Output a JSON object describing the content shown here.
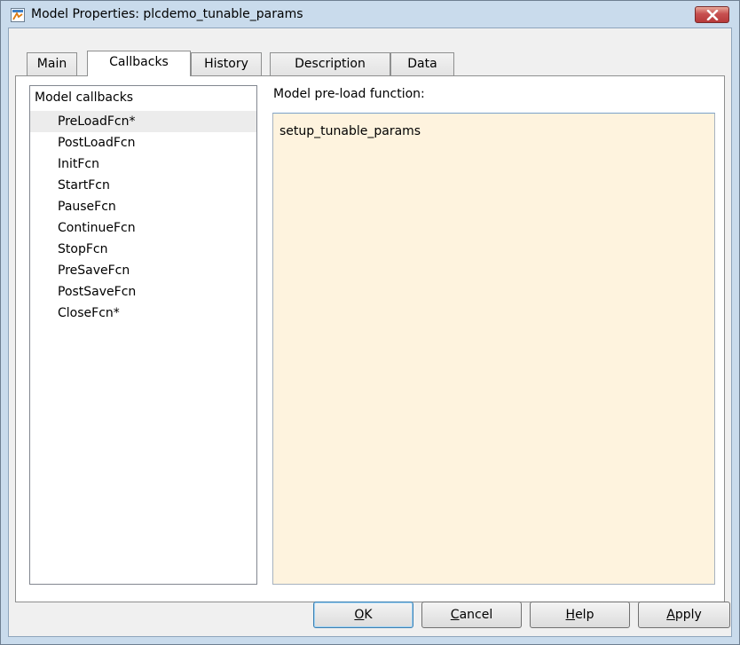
{
  "window": {
    "title": "Model Properties: plcdemo_tunable_params",
    "icon": "simulink-model-icon",
    "close_icon": "close-icon"
  },
  "tabs": [
    {
      "label": "Main",
      "active": false
    },
    {
      "label": "Callbacks",
      "active": true
    },
    {
      "label": "History",
      "active": false
    },
    {
      "label": "Description",
      "active": false
    },
    {
      "label": "Data",
      "active": false
    }
  ],
  "callbacks": {
    "list_header": "Model callbacks",
    "items": [
      {
        "label": "PreLoadFcn*",
        "selected": true
      },
      {
        "label": "PostLoadFcn",
        "selected": false
      },
      {
        "label": "InitFcn",
        "selected": false
      },
      {
        "label": "StartFcn",
        "selected": false
      },
      {
        "label": "PauseFcn",
        "selected": false
      },
      {
        "label": "ContinueFcn",
        "selected": false
      },
      {
        "label": "StopFcn",
        "selected": false
      },
      {
        "label": "PreSaveFcn",
        "selected": false
      },
      {
        "label": "PostSaveFcn",
        "selected": false
      },
      {
        "label": "CloseFcn*",
        "selected": false
      }
    ],
    "editor_label": "Model pre-load function:",
    "editor_value": "setup_tunable_params"
  },
  "buttons": {
    "ok": {
      "mnemonic": "O",
      "rest": "K"
    },
    "cancel": {
      "mnemonic": "C",
      "rest": "ancel"
    },
    "help": {
      "mnemonic": "H",
      "rest": "elp"
    },
    "apply": {
      "mnemonic": "A",
      "rest": "pply"
    }
  },
  "colors": {
    "editor_background": "#fef3de",
    "selection": "#ececec",
    "frame": "#c9dbec",
    "close_button": "#c75050"
  }
}
